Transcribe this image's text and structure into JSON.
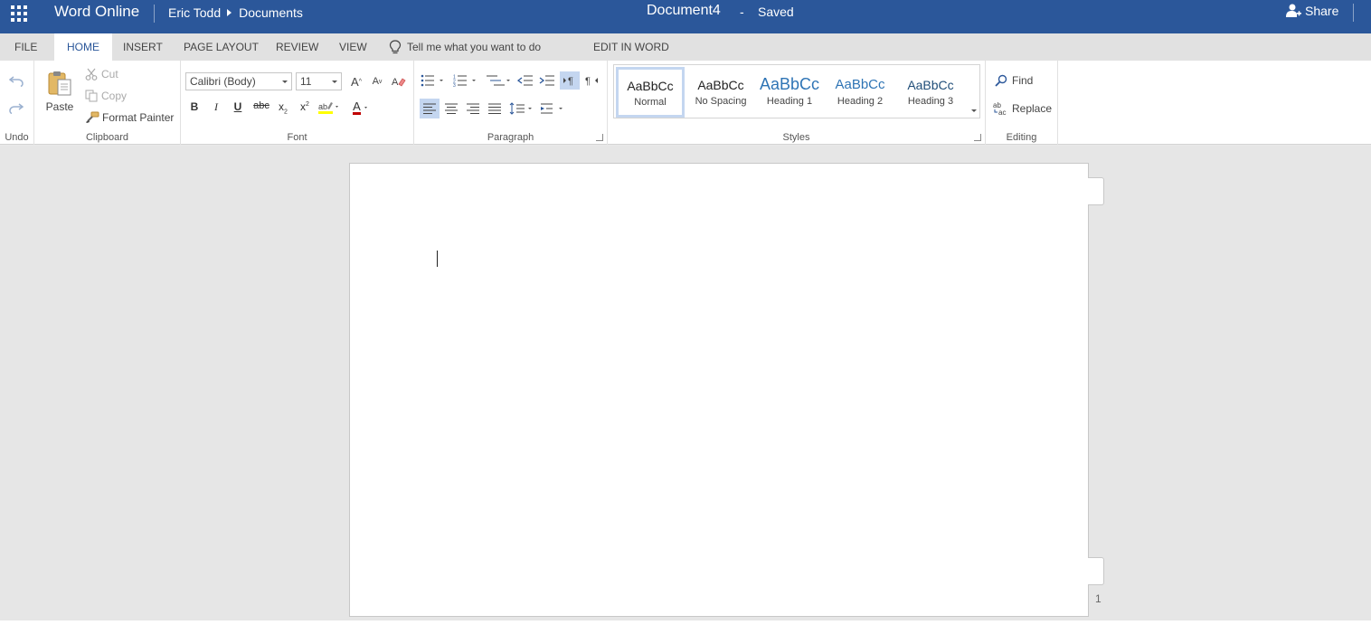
{
  "titlebar": {
    "app_name": "Word Online",
    "user": "Eric Todd",
    "folder": "Documents",
    "document_title": "Document4",
    "separator": "-",
    "save_status": "Saved",
    "share_label": "Share",
    "bg_color": "#2b579a"
  },
  "tabs": {
    "file": "FILE",
    "home": "HOME",
    "insert": "INSERT",
    "page_layout": "PAGE LAYOUT",
    "review": "REVIEW",
    "view": "VIEW",
    "tell_me_placeholder": "Tell me what you want to do",
    "edit_in_word": "EDIT IN WORD",
    "active": "HOME"
  },
  "ribbon": {
    "undo": {
      "label": "Undo",
      "icons": [
        "undo-icon",
        "redo-icon"
      ]
    },
    "clipboard": {
      "label": "Clipboard",
      "paste": "Paste",
      "cut": "Cut",
      "copy": "Copy",
      "format_painter": "Format Painter"
    },
    "font": {
      "label": "Font",
      "font_name": "Calibri (Body)",
      "font_size": "11",
      "bold": "B",
      "italic": "I",
      "underline": "U",
      "strikethrough": "abc",
      "subscript": "x",
      "superscript": "x",
      "font_color_letter": "A"
    },
    "paragraph": {
      "label": "Paragraph"
    },
    "styles": {
      "label": "Styles",
      "items": [
        {
          "sample": "AaBbCc",
          "name": "Normal",
          "selected": true
        },
        {
          "sample": "AaBbCc",
          "name": "No Spacing",
          "selected": false
        },
        {
          "sample": "AaBbCc",
          "name": "Heading 1",
          "selected": false
        },
        {
          "sample": "AaBbCc",
          "name": "Heading 2",
          "selected": false
        },
        {
          "sample": "AaBbCc",
          "name": "Heading 3",
          "selected": false
        }
      ]
    },
    "editing": {
      "label": "Editing",
      "find": "Find",
      "replace": "Replace"
    }
  },
  "document": {
    "page_number": "1"
  }
}
